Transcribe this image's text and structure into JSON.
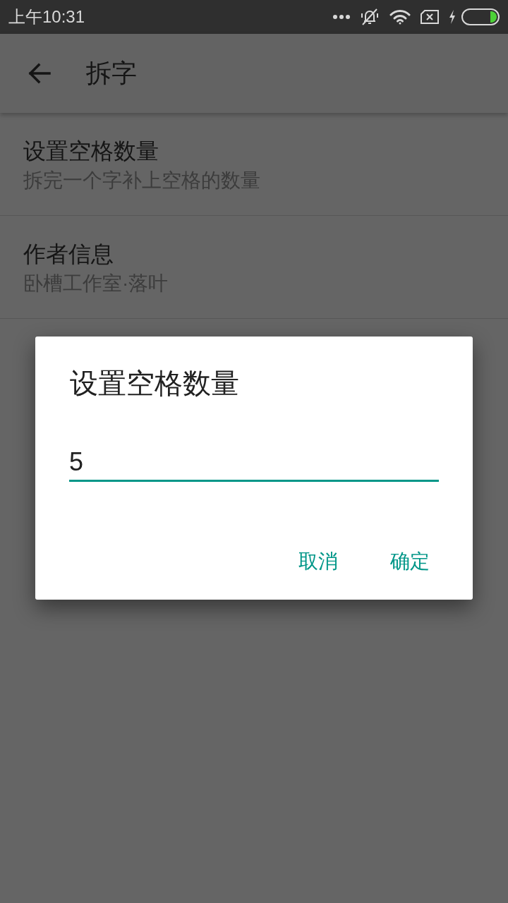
{
  "status_bar": {
    "time": "上午10:31"
  },
  "app_bar": {
    "title": "拆字"
  },
  "settings": [
    {
      "title": "设置空格数量",
      "summary": "拆完一个字补上空格的数量"
    },
    {
      "title": "作者信息",
      "summary": "卧槽工作室·落叶"
    }
  ],
  "dialog": {
    "title": "设置空格数量",
    "input": {
      "value": "5",
      "focused": true
    },
    "buttons": [
      {
        "label": "取消"
      },
      {
        "label": "确定"
      }
    ]
  }
}
